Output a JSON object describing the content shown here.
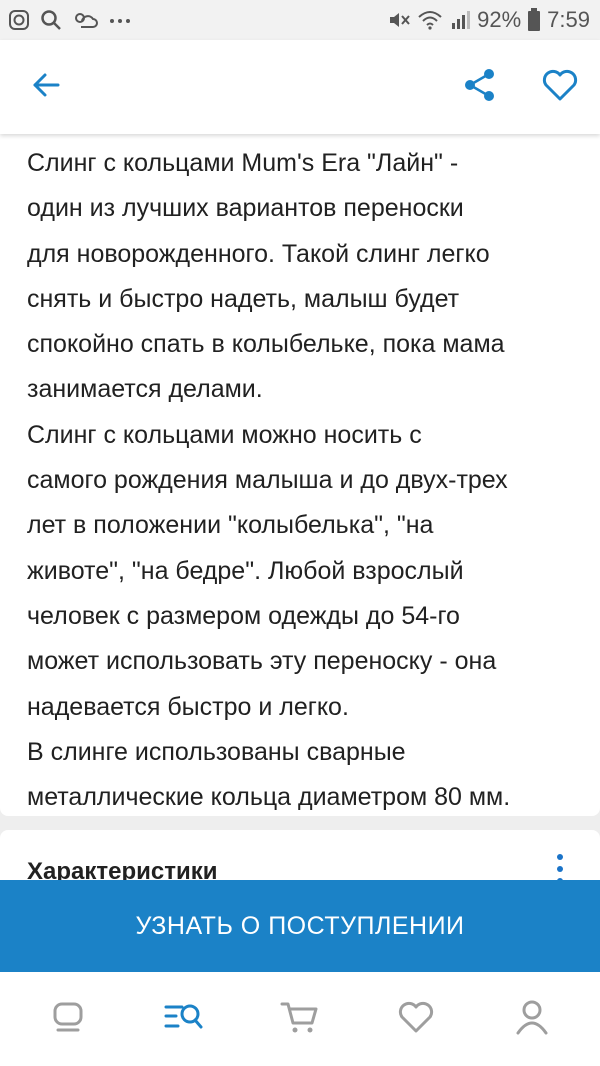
{
  "status_bar": {
    "battery_percent": "92%",
    "time": "7:59",
    "icons_left": [
      "instagram-icon",
      "search-icon",
      "weather-icon",
      "more-dots-icon"
    ],
    "icons_right": [
      "mute-icon",
      "wifi-icon",
      "signal-icon",
      "battery-icon"
    ]
  },
  "app_bar": {
    "icons": [
      "back-arrow-icon",
      "share-icon",
      "heart-icon"
    ],
    "accent_color": "#1b82c7"
  },
  "description": {
    "text": "Слинг с кольцами Mum's Era \"Лайн\" -\nодин из лучших вариантов переноски\nдля новорожденного. Такой слинг легко\nснять и быстро надеть, малыш будет\nспокойно спать в колыбельке, пока мама\nзанимается делами.\nСлинг с кольцами можно носить с\nсамого рождения малыша и до двух-трех\nлет в положении \"колыбелька\", \"на\nживоте\", \"на бедре\". Любой взрослый\nчеловек с размером одежды до 54-го\nможет использовать эту переноску - она\nнадевается быстро и легко.\nВ слинге использованы сварные\nметаллические кольца диаметром 80 мм."
  },
  "characteristics": {
    "title": "Характеристики"
  },
  "cta": {
    "label": "УЗНАТЬ О ПОСТУПЛЕНИИ",
    "color": "#1b82c7"
  },
  "bottom_nav": {
    "items": [
      "home-icon",
      "catalog-search-icon",
      "cart-icon",
      "favorites-icon",
      "profile-icon"
    ],
    "active": "catalog-search-icon",
    "active_color": "#1b82c7",
    "inactive_color": "#9e9e9e"
  }
}
